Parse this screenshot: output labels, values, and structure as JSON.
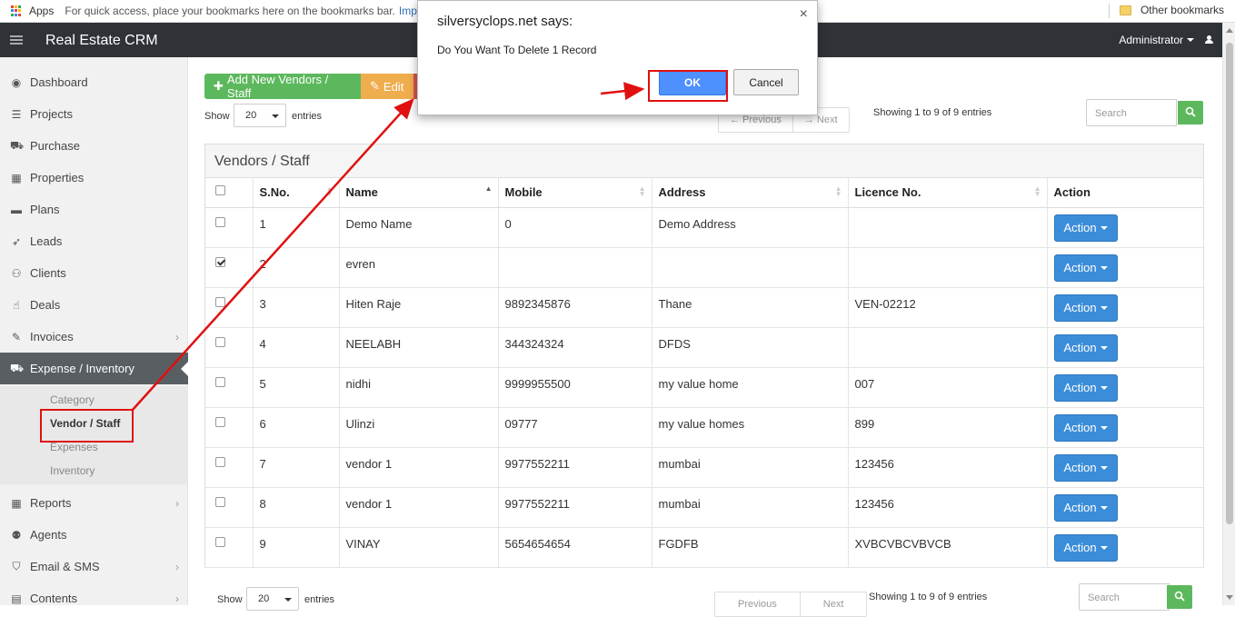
{
  "bookmarks_bar": {
    "apps_label": "Apps",
    "hint": "For quick access, place your bookmarks here on the bookmarks bar.",
    "import_link": "Impo",
    "other_bookmarks": "Other bookmarks"
  },
  "navbar": {
    "brand": "Real Estate CRM",
    "user": "Administrator"
  },
  "sidebar": {
    "items": [
      {
        "label": "Dashboard",
        "icon": "tachometer-icon",
        "glyph": "◉"
      },
      {
        "label": "Projects",
        "icon": "list-icon",
        "glyph": "☰"
      },
      {
        "label": "Purchase",
        "icon": "cart-icon",
        "glyph": "⛟"
      },
      {
        "label": "Properties",
        "icon": "building-icon",
        "glyph": "▦"
      },
      {
        "label": "Plans",
        "icon": "briefcase-icon",
        "glyph": "▬"
      },
      {
        "label": "Leads",
        "icon": "rocket-icon",
        "glyph": "➶"
      },
      {
        "label": "Clients",
        "icon": "users-icon",
        "glyph": "⚇"
      },
      {
        "label": "Deals",
        "icon": "thumbs-up-icon",
        "glyph": "☝"
      },
      {
        "label": "Invoices",
        "icon": "pin-icon",
        "glyph": "✎"
      },
      {
        "label": "Expense / Inventory",
        "icon": "cart-icon",
        "glyph": "⛟"
      }
    ],
    "submenu": [
      "Category",
      "Vendor / Staff",
      "Expenses",
      "Inventory"
    ],
    "items_after": [
      {
        "label": "Reports",
        "icon": "table-icon",
        "glyph": "▦"
      },
      {
        "label": "Agents",
        "icon": "user-secret-icon",
        "glyph": "⚉"
      },
      {
        "label": "Email & SMS",
        "icon": "shield-icon",
        "glyph": "⛉"
      },
      {
        "label": "Contents",
        "icon": "newspaper-icon",
        "glyph": "▤"
      }
    ]
  },
  "toolbar": {
    "add_label": "Add New Vendors / Staff",
    "edit_label": "Edit"
  },
  "listing": {
    "show_label": "Show",
    "page_size": "20",
    "entries_label": "entries",
    "prev_label": "← Previous",
    "next_label": "→ Next",
    "showing_text": "Showing 1 to 9 of 9 entries",
    "search_placeholder": "Search"
  },
  "panel": {
    "title": "Vendors / Staff"
  },
  "table": {
    "headers": [
      "S.No.",
      "Name",
      "Mobile",
      "Address",
      "Licence No.",
      "Action"
    ],
    "action_label": "Action",
    "rows": [
      {
        "sno": "1",
        "name": "Demo Name",
        "mobile": "0",
        "address": "Demo Address",
        "licence": "",
        "checked": false
      },
      {
        "sno": "2",
        "name": "evren",
        "mobile": "",
        "address": "",
        "licence": "",
        "checked": true
      },
      {
        "sno": "3",
        "name": "Hiten Raje",
        "mobile": "9892345876",
        "address": "Thane",
        "licence": "VEN-02212",
        "checked": false
      },
      {
        "sno": "4",
        "name": "NEELABH",
        "mobile": "344324324",
        "address": "DFDS",
        "licence": "",
        "checked": false
      },
      {
        "sno": "5",
        "name": "nidhi",
        "mobile": "9999955500",
        "address": "my value home",
        "licence": "007",
        "checked": false
      },
      {
        "sno": "6",
        "name": "Ulinzi",
        "mobile": "09777",
        "address": "my value homes",
        "licence": "899",
        "checked": false
      },
      {
        "sno": "7",
        "name": "vendor 1",
        "mobile": "9977552211",
        "address": "mumbai",
        "licence": "123456",
        "checked": false
      },
      {
        "sno": "8",
        "name": "vendor 1",
        "mobile": "9977552211",
        "address": "mumbai",
        "licence": "123456",
        "checked": false
      },
      {
        "sno": "9",
        "name": "VINAY",
        "mobile": "5654654654",
        "address": "FGDFB",
        "licence": "XVBCVBCVBVCB",
        "checked": false
      }
    ]
  },
  "bottom_listing": {
    "show_label": "Show",
    "page_size": "20",
    "entries_label": "entries",
    "prev_label": "Previous",
    "next_label": "Next",
    "showing_text": "Showing 1 to 9 of 9 entries",
    "search_placeholder": "Search"
  },
  "dialog": {
    "title": "silversyclops.net says:",
    "message": "Do You Want To Delete 1 Record",
    "ok_label": "OK",
    "cancel_label": "Cancel"
  },
  "colors": {
    "navbar": "#2f3338",
    "active_menu": "#595e63",
    "add_button": "#5cb85c",
    "edit_button": "#f0ad4e",
    "delete_button": "#d9534f",
    "action_button": "#3c8dd9",
    "annotation": "#e01010"
  }
}
